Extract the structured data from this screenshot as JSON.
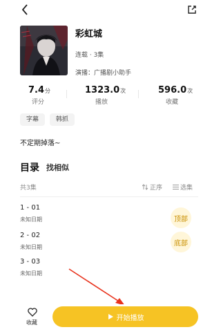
{
  "header": {
    "back_icon": "chevron-left-icon",
    "share_icon": "share-icon"
  },
  "album": {
    "title": "彩虹城",
    "meta": "连载 · 3集",
    "cast": "演播：广播剧小助手"
  },
  "stats": [
    {
      "value": "7.4",
      "unit": "分",
      "label": "评分"
    },
    {
      "value": "1323.0",
      "unit": "次",
      "label": "播放"
    },
    {
      "value": "596.0",
      "unit": "次",
      "label": "收藏"
    }
  ],
  "tags": [
    "字幕",
    "韩抓"
  ],
  "description": "不定期掉落~",
  "catalog": {
    "title": "目录",
    "similar": "找相似",
    "count": "共3集",
    "sort_label": "正序",
    "select_label": "选集",
    "episodes": [
      {
        "title": "1 - 01",
        "date": "未知日期"
      },
      {
        "title": "2 - 02",
        "date": "未知日期"
      },
      {
        "title": "3 - 03",
        "date": "未知日期"
      }
    ],
    "top_label": "顶部",
    "bottom_label": "底部"
  },
  "bottom": {
    "fav_label": "收藏",
    "play_label": "开始播放"
  },
  "colors": {
    "accent": "#f6c324",
    "arrow": "#e8321c"
  }
}
